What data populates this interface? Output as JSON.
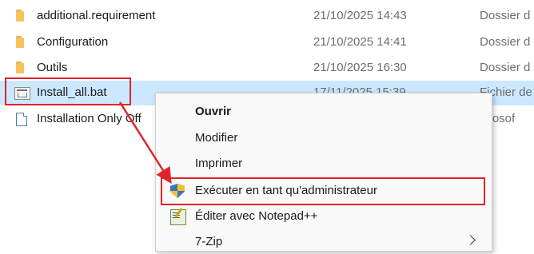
{
  "files": [
    {
      "name": "additional.requirement",
      "date": "21/10/2025 14:43",
      "type": "Dossier d",
      "icon": "folder-icon"
    },
    {
      "name": "Configuration",
      "date": "21/10/2025 14:41",
      "type": "Dossier d",
      "icon": "folder-icon"
    },
    {
      "name": "Outils",
      "date": "21/10/2025 16:30",
      "type": "Dossier d",
      "icon": "folder-icon"
    },
    {
      "name": "Install_all.bat",
      "date": "17/11/2025 15:39",
      "type": "Fichier de",
      "icon": "batch-file-icon",
      "selected": true
    },
    {
      "name": "Installation Only Off",
      "date": "",
      "type": "icrosof",
      "icon": "document-icon"
    }
  ],
  "context_menu": {
    "items": [
      {
        "label": "Ouvrir",
        "bold": true
      },
      {
        "label": "Modifier"
      },
      {
        "label": "Imprimer"
      },
      {
        "label": "Exécuter en tant qu'administrateur",
        "icon": "uac-shield-icon"
      },
      {
        "label": "Éditer avec Notepad++",
        "icon": "notepad-plus-plus-icon"
      },
      {
        "label": "7-Zip",
        "submenu": true
      }
    ]
  },
  "colors": {
    "selection": "#cce8ff",
    "annotation_red": "#e0242a",
    "folder": "#f3c55c"
  }
}
